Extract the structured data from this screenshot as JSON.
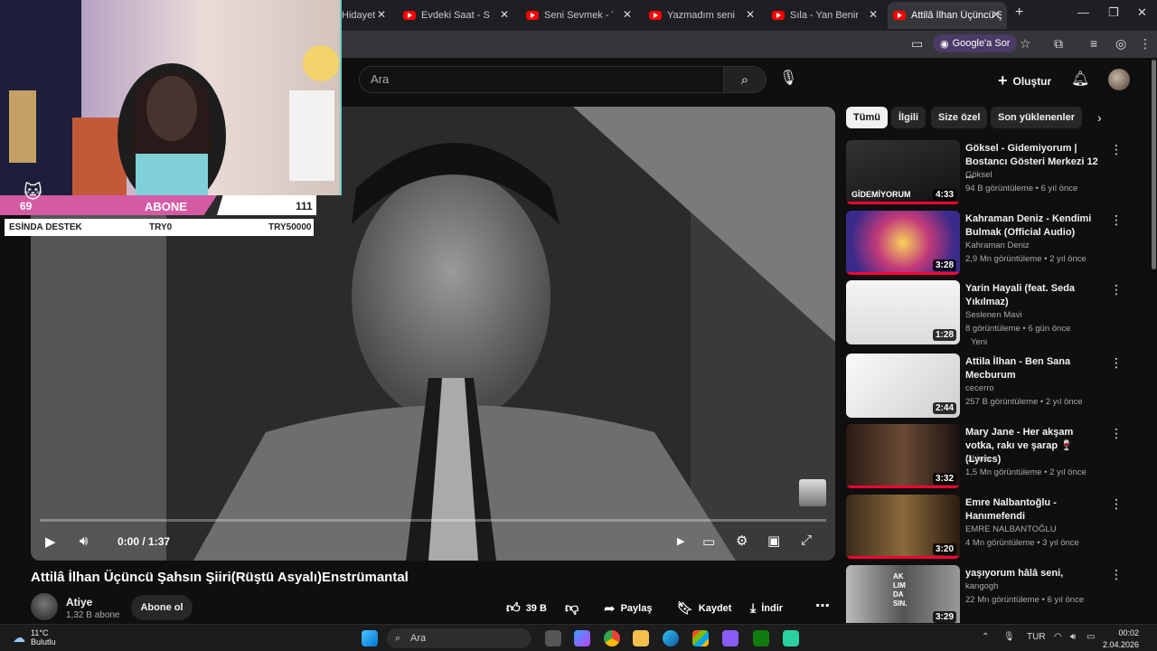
{
  "browser": {
    "tabs": [
      {
        "title": "Hidayet",
        "active": false
      },
      {
        "title": "Evdeki Saat - Sustur",
        "active": false
      },
      {
        "title": "Seni Sevmek - YouTu",
        "active": false
      },
      {
        "title": "Yazmadım seni daha",
        "active": false
      },
      {
        "title": "Sıla - Yan Benimle (K",
        "active": false
      },
      {
        "title": "Attilâ İlhan Üçüncü Ş",
        "active": true
      }
    ],
    "google_ask": "Google'a Sor"
  },
  "header": {
    "search_placeholder": "Ara",
    "create_label": "Oluştur"
  },
  "overlay": {
    "count_left": "69",
    "title": "ABONE",
    "count_right": "111",
    "row_left": "ESİNDA DESTEK",
    "row_mid": "TRY0",
    "row_right": "TRY50000"
  },
  "player": {
    "time": "0:00 / 1:37",
    "progress": 0
  },
  "video": {
    "title": "Attilâ İlhan Üçüncü Şahsın Şiiri(Rüştü Asyalı)Enstrümantal",
    "channel": "Atiye",
    "subscribers": "1,32 B abone",
    "subscribe_label": "Abone ol",
    "likes": "39 B",
    "share_label": "Paylaş",
    "save_label": "Kaydet",
    "download_label": "İndir"
  },
  "sidebar": {
    "chips": [
      "Tümü",
      "İlgili",
      "Size özel",
      "Son yüklenenler"
    ],
    "items": [
      {
        "title": "Göksel - Gidemiyorum | Bostancı Gösteri Merkezi 12 ...",
        "channel": "Göksel",
        "meta": "94 B görüntüleme • 6 yıl önce",
        "duration": "4:33",
        "verified": true,
        "badge": "",
        "thumb_text": "GİDEMİYORUM"
      },
      {
        "title": "Kahraman Deniz - Kendimi Bulmak (Official Audio)",
        "channel": "Kahraman Deniz",
        "meta": "2,9 Mn görüntüleme • 2 yıl önce",
        "duration": "3:28",
        "verified": true,
        "badge": "",
        "thumb_text": ""
      },
      {
        "title": "Yarin Hayali (feat. Seda Yıkılmaz)",
        "channel": "Seslenen Mavi",
        "meta": "8 görüntüleme • 6 gün önce",
        "duration": "1:28",
        "verified": true,
        "badge": "Yeni",
        "thumb_text": ""
      },
      {
        "title": "Attila İlhan - Ben Sana Mecburum",
        "channel": "cecerro",
        "meta": "257 B görüntüleme • 2 yıl önce",
        "duration": "2:44",
        "verified": false,
        "badge": "",
        "thumb_text": ""
      },
      {
        "title": "Mary Jane - Her akşam votka, rakı ve şarap 🍷 (Lyrics)",
        "channel": "LiLium",
        "meta": "1,5 Mn görüntüleme • 2 yıl önce",
        "duration": "3:32",
        "verified": false,
        "badge": "",
        "thumb_text": ""
      },
      {
        "title": "Emre Nalbantoğlu - Hanımefendi",
        "channel": "EMRE NALBANTOĞLU",
        "meta": "4 Mn görüntüleme • 3 yıl önce",
        "duration": "3:20",
        "verified": true,
        "badge": "",
        "thumb_text": ""
      },
      {
        "title": "yaşıyorum hâlâ seni,",
        "channel": "kangogh",
        "meta": "22 Mn görüntüleme • 6 yıl önce",
        "duration": "3:29",
        "verified": false,
        "badge": "",
        "thumb_text": "AK LIM DA SIN."
      }
    ]
  },
  "taskbar": {
    "temperature": "11°C",
    "weather": "Bulutlu",
    "search": "Ara",
    "language": "TUR",
    "time": "00:02",
    "date": "2.04.2026"
  },
  "colors": {
    "accent": "#ff0033",
    "background": "#0f0f0f",
    "overlay_pink": "#d45ba3"
  }
}
